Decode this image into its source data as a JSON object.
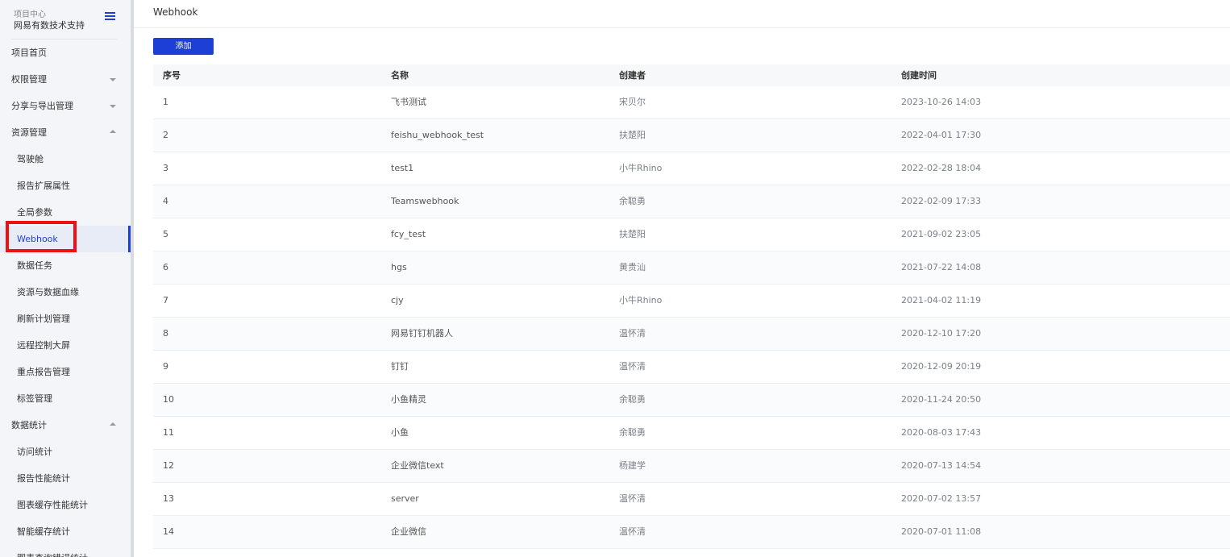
{
  "sidebar": {
    "project_label": "项目中心",
    "project_name": "网易有数技术支持",
    "items": [
      {
        "label": "项目首页",
        "level": 1,
        "arrow": ""
      },
      {
        "label": "权限管理",
        "level": 1,
        "arrow": "down"
      },
      {
        "label": "分享与导出管理",
        "level": 1,
        "arrow": "down"
      },
      {
        "label": "资源管理",
        "level": 1,
        "arrow": "up"
      },
      {
        "label": "驾驶舱",
        "level": 2,
        "arrow": ""
      },
      {
        "label": "报告扩展属性",
        "level": 2,
        "arrow": ""
      },
      {
        "label": "全局参数",
        "level": 2,
        "arrow": ""
      },
      {
        "label": "Webhook",
        "level": 2,
        "arrow": "",
        "active": true
      },
      {
        "label": "数据任务",
        "level": 2,
        "arrow": ""
      },
      {
        "label": "资源与数据血缘",
        "level": 2,
        "arrow": ""
      },
      {
        "label": "刷新计划管理",
        "level": 2,
        "arrow": ""
      },
      {
        "label": "远程控制大屏",
        "level": 2,
        "arrow": ""
      },
      {
        "label": "重点报告管理",
        "level": 2,
        "arrow": ""
      },
      {
        "label": "标签管理",
        "level": 2,
        "arrow": ""
      },
      {
        "label": "数据统计",
        "level": 1,
        "arrow": "up"
      },
      {
        "label": "访问统计",
        "level": 2,
        "arrow": ""
      },
      {
        "label": "报告性能统计",
        "level": 2,
        "arrow": ""
      },
      {
        "label": "图表缓存性能统计",
        "level": 2,
        "arrow": ""
      },
      {
        "label": "智能缓存统计",
        "level": 2,
        "arrow": ""
      },
      {
        "label": "图表查询错误统计",
        "level": 2,
        "arrow": ""
      }
    ]
  },
  "header": {
    "title": "Webhook"
  },
  "toolbar": {
    "add_label": "添加"
  },
  "table": {
    "columns": [
      "序号",
      "名称",
      "创建者",
      "创建时间"
    ],
    "rows": [
      [
        "1",
        "飞书测试",
        "宋贝尔",
        "2023-10-26 14:03"
      ],
      [
        "2",
        "feishu_webhook_test",
        "扶楚阳",
        "2022-04-01 17:30"
      ],
      [
        "3",
        "test1",
        "小牛Rhino",
        "2022-02-28 18:04"
      ],
      [
        "4",
        "Teamswebhook",
        "余聪勇",
        "2022-02-09 17:33"
      ],
      [
        "5",
        "fcy_test",
        "扶楚阳",
        "2021-09-02 23:05"
      ],
      [
        "6",
        "hgs",
        "黄贵汕",
        "2021-07-22 14:08"
      ],
      [
        "7",
        "cjy",
        "小牛Rhino",
        "2021-04-02 11:19"
      ],
      [
        "8",
        "网易钉钉机器人",
        "温怀清",
        "2020-12-10 17:20"
      ],
      [
        "9",
        "钉钉",
        "温怀清",
        "2020-12-09 20:19"
      ],
      [
        "10",
        "小鱼精灵",
        "余聪勇",
        "2020-11-24 20:50"
      ],
      [
        "11",
        "小鱼",
        "余聪勇",
        "2020-08-03 17:43"
      ],
      [
        "12",
        "企业微信text",
        "杨建学",
        "2020-07-13 14:54"
      ],
      [
        "13",
        "server",
        "温怀清",
        "2020-07-02 13:57"
      ],
      [
        "14",
        "企业微信",
        "温怀清",
        "2020-07-01 11:08"
      ]
    ]
  },
  "colors": {
    "accent": "#1d3fd6",
    "highlight": "#ee1111"
  }
}
